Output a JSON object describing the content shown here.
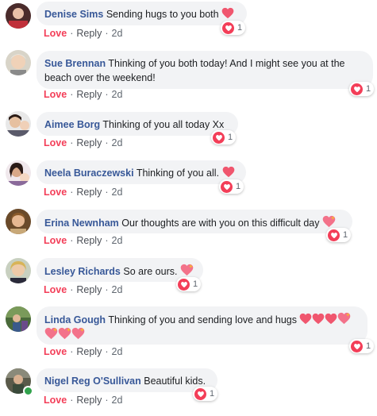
{
  "actions": {
    "love": "Love",
    "reply": "Reply",
    "separator": "·"
  },
  "comments": [
    {
      "author": "Denise Sims",
      "text": "Sending hugs to you both",
      "time": "2d",
      "reaction_count": "1"
    },
    {
      "author": "Sue Brennan",
      "text": "Thinking of you both today! And I might see you at the",
      "text2": "beach over the weekend!",
      "time": "2d",
      "reaction_count": "1"
    },
    {
      "author": "Aimee Borg",
      "text": "Thinking of you all today Xx",
      "time": "2d",
      "reaction_count": "1"
    },
    {
      "author": "Neela Buraczewski",
      "text": "Thinking of you all.",
      "time": "2d",
      "reaction_count": "1"
    },
    {
      "author": "Erina Newnham",
      "text": "Our thoughts are with you on this difficult day",
      "time": "2d",
      "reaction_count": "1"
    },
    {
      "author": "Lesley Richards",
      "text": "So are ours.",
      "time": "2d",
      "reaction_count": "1"
    },
    {
      "author": "Linda Gough",
      "text": "Thinking of you and sending love and hugs",
      "time": "2d",
      "reaction_count": "1"
    },
    {
      "author": "Nigel Reg O'Sullivan",
      "text": "Beautiful kids.",
      "time": "2d",
      "reaction_count": "1"
    }
  ],
  "colors": {
    "author": "#385898",
    "love": "#f33e58",
    "bubble": "#f2f3f5",
    "online": "#31a24c"
  },
  "icons": {
    "reaction": "love-heart-icon",
    "emoji": "heart-emoji-icon",
    "sparkle": "sparkling-heart-icon"
  }
}
